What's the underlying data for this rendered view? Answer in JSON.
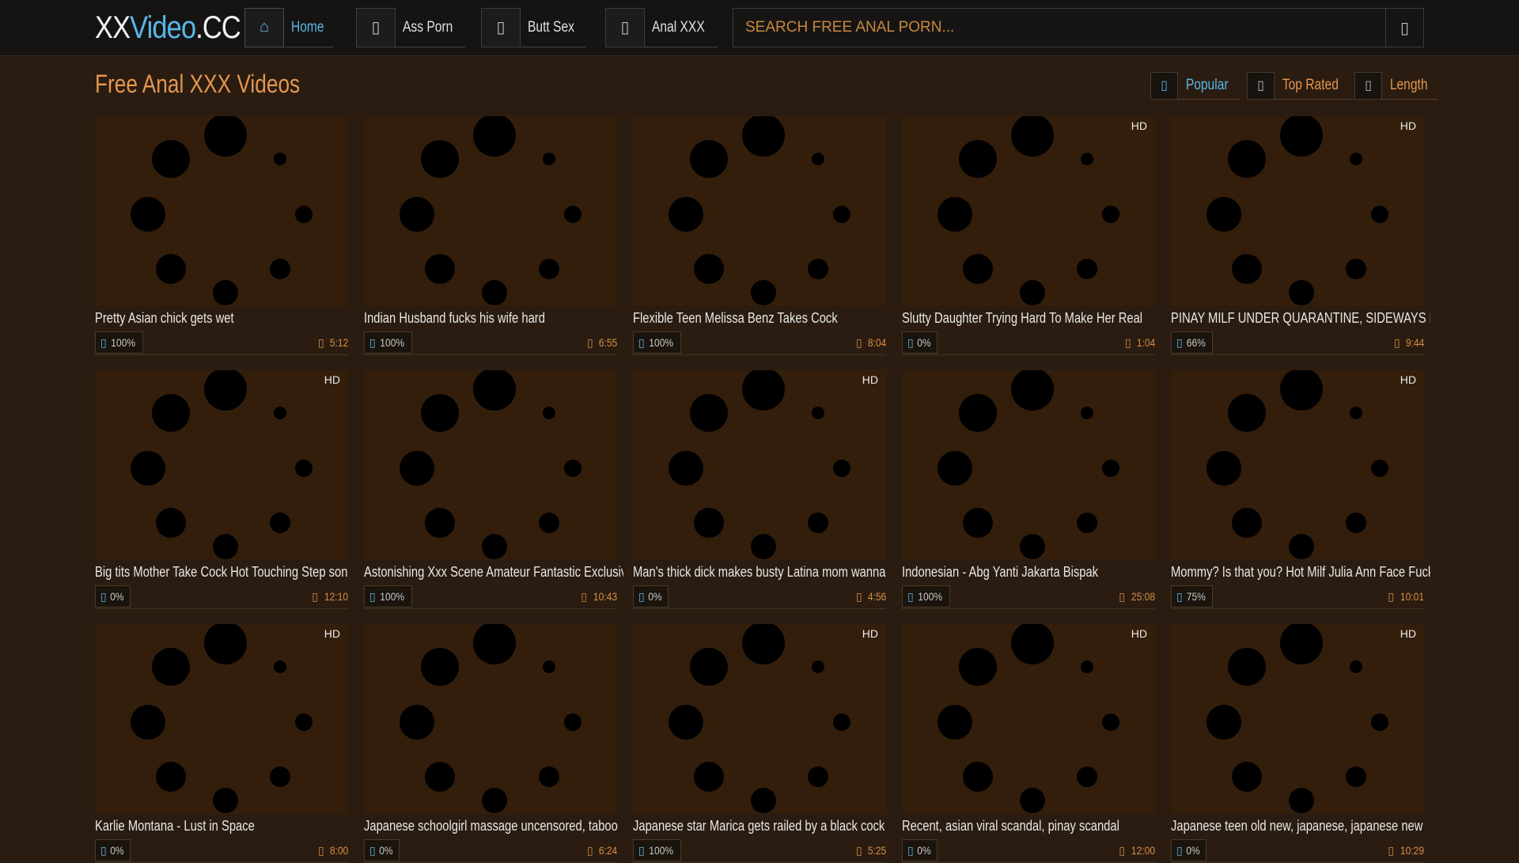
{
  "site": {
    "logo_part1": "XX",
    "logo_part2": "Video",
    "logo_part3": ".CC"
  },
  "nav": [
    {
      "label": "Home",
      "icon": "home-icon",
      "active": true
    },
    {
      "label": "Ass Porn",
      "icon": "tag-icon",
      "active": false
    },
    {
      "label": "Butt Sex",
      "icon": "tag-icon",
      "active": false
    },
    {
      "label": "Anal XXX",
      "icon": "tag-icon",
      "active": false
    }
  ],
  "search": {
    "placeholder": "SEARCH FREE ANAL PORN..."
  },
  "page_title": "Free Anal XXX Videos",
  "sort": [
    {
      "label": "Popular",
      "icon": "fire-icon",
      "active": true
    },
    {
      "label": "Top Rated",
      "icon": "star-icon",
      "active": false
    },
    {
      "label": "Length",
      "icon": "clock-icon",
      "active": false
    }
  ],
  "videos": [
    {
      "title": "Pretty Asian chick gets wet",
      "rating": "100%",
      "duration": "5:12",
      "hd": ""
    },
    {
      "title": "Indian Husband fucks his wife hard",
      "rating": "100%",
      "duration": "6:55",
      "hd": ""
    },
    {
      "title": "Flexible Teen Melissa Benz Takes Cock",
      "rating": "100%",
      "duration": "8:04",
      "hd": ""
    },
    {
      "title": "Slutty Daughter Trying Hard To Make Her Real",
      "rating": "0%",
      "duration": "1:04",
      "hd": "HD"
    },
    {
      "title": "PINAY MILF UNDER QUARANTINE, SIDEWAYS FUCK",
      "rating": "66%",
      "duration": "9:44",
      "hd": "HD"
    },
    {
      "title": "Big tits Mother Take Cock Hot Touching Step son",
      "rating": "0%",
      "duration": "12:10",
      "hd": "HD"
    },
    {
      "title": "Astonishing Xxx Scene Amateur Fantastic Exclusive",
      "rating": "100%",
      "duration": "10:43",
      "hd": ""
    },
    {
      "title": "Man's thick dick makes busty Latina mom wanna",
      "rating": "0%",
      "duration": "4:56",
      "hd": "HD"
    },
    {
      "title": "Indonesian - Abg Yanti Jakarta Bispak",
      "rating": "100%",
      "duration": "25:08",
      "hd": ""
    },
    {
      "title": "Mommy? Is that you? Hot Milf Julia Ann Face Fucks",
      "rating": "75%",
      "duration": "10:01",
      "hd": "HD"
    },
    {
      "title": "Karlie Montana - Lust in Space",
      "rating": "0%",
      "duration": "8:00",
      "hd": "HD"
    },
    {
      "title": "Japanese schoolgirl massage uncensored, taboo",
      "rating": "0%",
      "duration": "6:24",
      "hd": ""
    },
    {
      "title": "Japanese star Marica gets railed by a black cock",
      "rating": "100%",
      "duration": "5:25",
      "hd": "HD"
    },
    {
      "title": "Recent, asian viral scandal, pinay scandal",
      "rating": "0%",
      "duration": "12:00",
      "hd": "HD"
    },
    {
      "title": "Japanese teen old new, japanese, japanese new",
      "rating": "0%",
      "duration": "10:29",
      "hd": "HD"
    }
  ],
  "colors": {
    "accent": "#59b6e6",
    "orange": "#e3964f",
    "background": "#2a1c10",
    "header": "#151413"
  }
}
